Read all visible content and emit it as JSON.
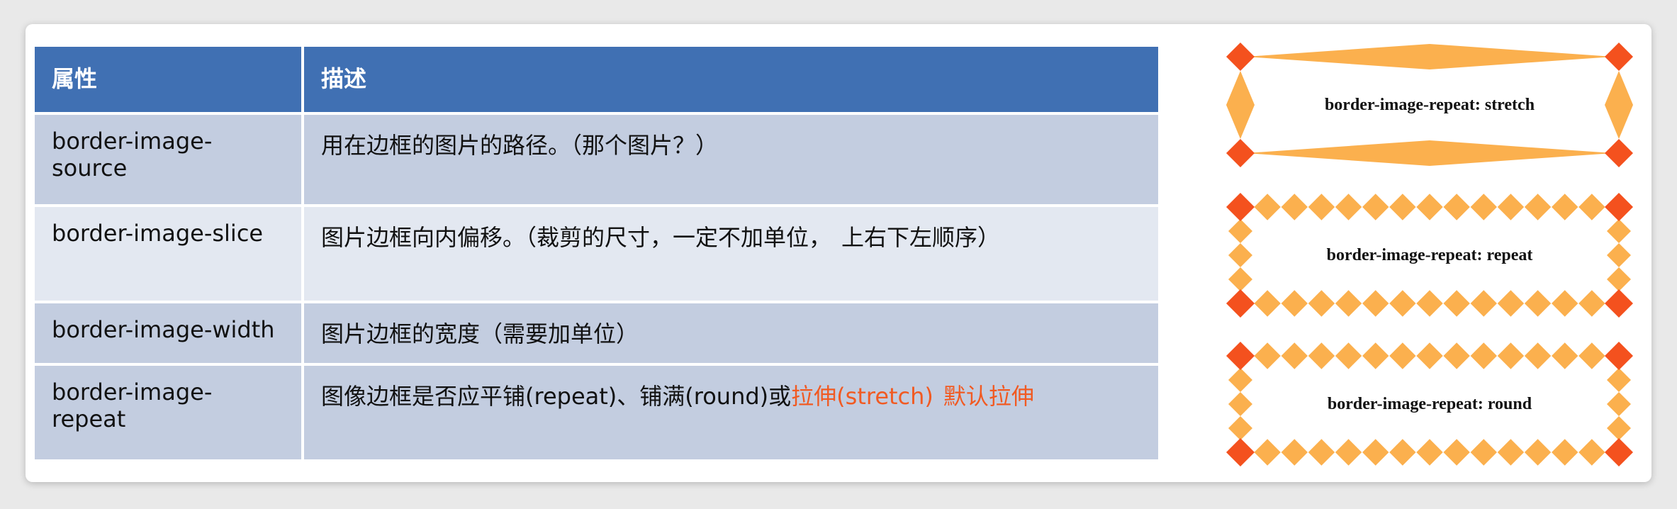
{
  "table": {
    "headers": {
      "property": "属性",
      "description": "描述"
    },
    "rows": [
      {
        "property": "border-image-source",
        "description": "用在边框的图片的路径。（那个图片？）"
      },
      {
        "property": "border-image-slice",
        "description": "图片边框向内偏移。（裁剪的尺寸，一定不加单位，",
        "description_tail": "上右下左顺序）"
      },
      {
        "property": "border-image-width",
        "description": "图片边框的宽度（需要加单位）"
      },
      {
        "property": "border-image-repeat",
        "description": "图像边框是否应平铺(repeat)、铺满(round)或",
        "description_highlight": "拉伸(stretch)",
        "description_highlight2": "默认拉伸"
      }
    ]
  },
  "examples": [
    {
      "label": "border-image-repeat: stretch"
    },
    {
      "label": "border-image-repeat: repeat"
    },
    {
      "label": "border-image-repeat: round"
    }
  ],
  "colors": {
    "header_bg": "#4070b3",
    "row_dark": "#c3cde0",
    "row_light": "#e3e8f1",
    "highlight": "#f15a22",
    "diamond_corner": "#f4511e",
    "diamond_fill": "#fbb04e"
  }
}
